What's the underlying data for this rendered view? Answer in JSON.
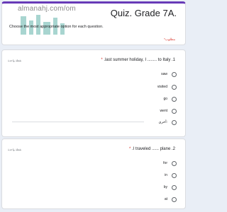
{
  "header": {
    "watermark": "almanahj.com/om",
    "title": "Quiz. Grade 7A.",
    "instruction": "Choose the most appropriate option for each question.",
    "required_note": "*مطلوب"
  },
  "questions": [
    {
      "points": "نقطة واحدة",
      "text": ".last summer holiday, I ........ to Italy .1",
      "required_mark": "*",
      "options": [
        "saw",
        "visited",
        "go",
        "went",
        "أخرى:"
      ]
    },
    {
      "points": "نقطة واحدة",
      "text": ".I traveled ...... plane .2",
      "required_mark": "*",
      "options": [
        "for",
        "in",
        "by",
        "at"
      ]
    }
  ],
  "colors": {
    "accent": "#673ab7",
    "required": "#d93025",
    "background": "#e9eef6"
  },
  "logo_icon": "almanahj-logo-watermark"
}
